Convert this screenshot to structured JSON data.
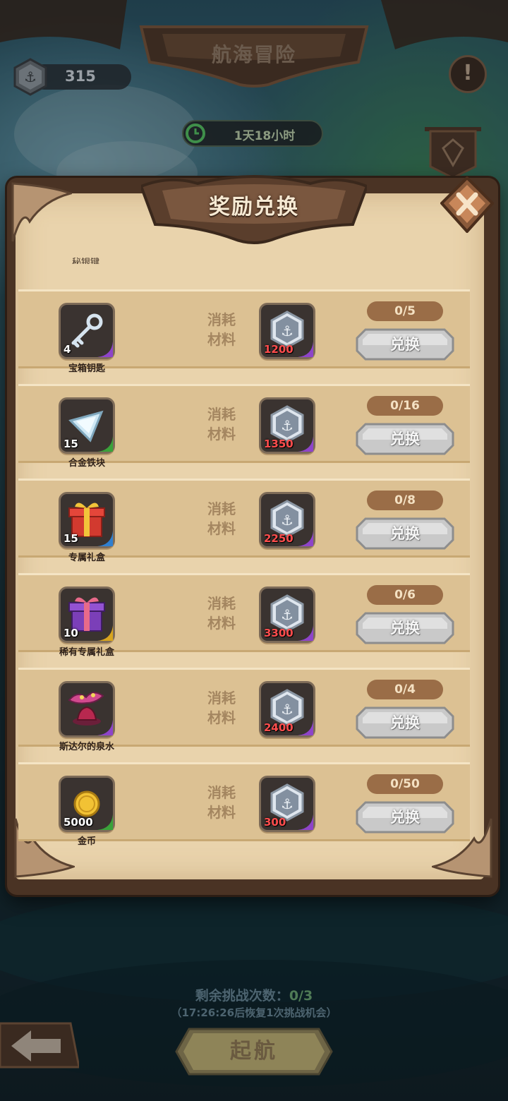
{
  "header": {
    "title": "航海冒险",
    "currency_amount": "315",
    "info_label": "!",
    "timer": "1天18小时"
  },
  "modal": {
    "title": "奖励兑换",
    "partial_item_label": "秘银键",
    "cost_label_line1": "消耗",
    "cost_label_line2": "材料",
    "exchange_label": "兑换",
    "items": [
      {
        "name": "宝箱钥匙",
        "qty": "4",
        "icon": "key-icon",
        "rarity_color": "#8e44c9",
        "cost": "1200",
        "limit": "0/5"
      },
      {
        "name": "合金铁块",
        "qty": "15",
        "icon": "alloy-ingot-icon",
        "rarity_color": "#3aa23a",
        "cost": "1350",
        "limit": "0/16"
      },
      {
        "name": "专属礼盒",
        "qty": "15",
        "icon": "gift-box-red-icon",
        "rarity_color": "#2f7fd0",
        "cost": "2250",
        "limit": "0/8"
      },
      {
        "name": "稀有专属礼盒",
        "qty": "10",
        "icon": "gift-box-purple-icon",
        "rarity_color": "#d8a51f",
        "cost": "3300",
        "limit": "0/6"
      },
      {
        "name": "斯达尔的泉水",
        "qty": "",
        "icon": "fountain-icon",
        "rarity_color": "#8e44c9",
        "cost": "2400",
        "limit": "0/4"
      },
      {
        "name": "金币",
        "qty": "5000",
        "icon": "gold-coin-icon",
        "rarity_color": "#3aa23a",
        "cost": "300",
        "limit": "0/50"
      }
    ]
  },
  "footer": {
    "remaining_label": "剩余挑战次数：",
    "remaining_value": "0/3",
    "recover_text": "（17:26:26后恢复1次挑战机会）",
    "sail_label": "起航"
  },
  "colors": {
    "material_qty": "#ff4d4d",
    "limit_pill": "#9a6d47",
    "parchment": "#e9d3ac"
  }
}
